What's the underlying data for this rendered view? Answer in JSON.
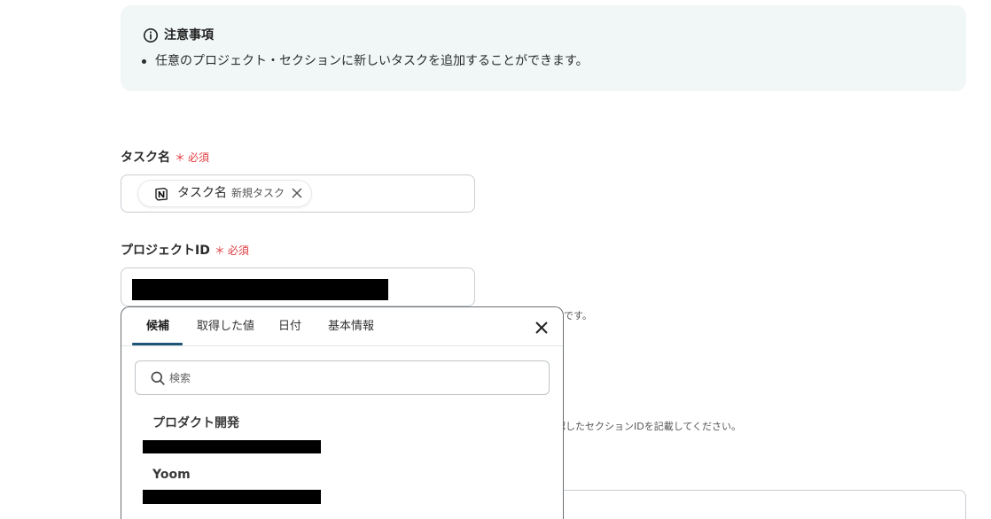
{
  "notice": {
    "icon": "info-icon",
    "title": "注意事項",
    "items": [
      "任意のプロジェクト・セクションに新しいタスクを追加することができます。"
    ]
  },
  "task_name": {
    "label": "タスク名",
    "required_mark": "＊",
    "required_label": "必須",
    "chip": {
      "icon": "notion-icon",
      "label": "タスク名",
      "value": "新規タスク"
    }
  },
  "project_id": {
    "label": "プロジェクトID",
    "required_mark": "＊",
    "required_label": "必須",
    "value_redacted": true,
    "help_text": "です。"
  },
  "section_id": {
    "help_text": "認したセクションIDを記載してください。"
  },
  "dropdown": {
    "tabs": [
      {
        "label": "候補",
        "active": true
      },
      {
        "label": "取得した値",
        "active": false
      },
      {
        "label": "日付",
        "active": false
      },
      {
        "label": "基本情報",
        "active": false
      }
    ],
    "close_icon": "close-icon",
    "search": {
      "icon": "search-icon",
      "placeholder": "検索",
      "value": ""
    },
    "options": [
      {
        "label": "プロダクト開発",
        "id_redacted": true
      },
      {
        "label": "Yoom",
        "id_redacted": true
      }
    ]
  },
  "colors": {
    "notice_bg": "#f1f7f7",
    "required": "#e0393e",
    "tab_active": "#1f5578",
    "redaction": "#000000"
  }
}
